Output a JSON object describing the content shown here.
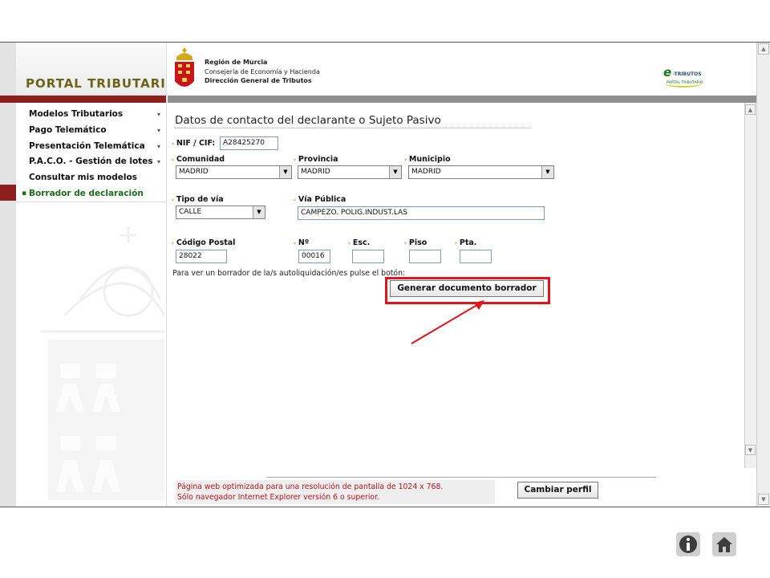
{
  "sidebar": {
    "title": "PORTAL TRIBUTARIO",
    "items": [
      {
        "label": "Modelos Tributarios",
        "expandable": true
      },
      {
        "label": "Pago Telemático",
        "expandable": true
      },
      {
        "label": "Presentación Telemática",
        "expandable": true
      },
      {
        "label": "P.A.C.O. - Gestión de lotes",
        "expandable": true
      },
      {
        "label": "Consultar mis modelos",
        "expandable": false
      },
      {
        "label": "Borrador de declaración",
        "expandable": false,
        "active": true
      }
    ]
  },
  "header": {
    "org_line1": "Región de Murcia",
    "org_line2": "Consejería de Economía y Hacienda",
    "org_line3": "Dirección General de Tributos",
    "brand_big": "e",
    "brand_text": "-TRIBUTOS",
    "brand_sub": "PORTAL TRIBUTARIO"
  },
  "form": {
    "title": "Datos de contacto del declarante o Sujeto Pasivo",
    "nif": {
      "label": "NIF / CIF:",
      "value": "A28425270"
    },
    "comunidad": {
      "label": "Comunidad",
      "value": "MADRID"
    },
    "provincia": {
      "label": "Provincia",
      "value": "MADRID"
    },
    "municipio": {
      "label": "Municipio",
      "value": "MADRID"
    },
    "tipo_via": {
      "label": "Tipo de vía",
      "value": "CALLE"
    },
    "via_publica": {
      "label": "Vía Pública",
      "value": "CAMPEZO. POLIG.INDUST.LAS"
    },
    "codigo_postal": {
      "label": "Código Postal",
      "value": "28022"
    },
    "numero": {
      "label": "Nº",
      "value": "00016"
    },
    "esc": {
      "label": "Esc.",
      "value": ""
    },
    "piso": {
      "label": "Piso",
      "value": ""
    },
    "pta": {
      "label": "Pta.",
      "value": ""
    },
    "hint": "Para ver un borrador de la/s autoliquidación/es pulse el botón:",
    "generate_button": "Generar documento borrador"
  },
  "footer": {
    "line1": "Página web optimizada para una resolución de pantalla de 1024 x 768.",
    "line2": "Sólo navegador Internet Explorer versión 6 o superior.",
    "change_profile_button": "Cambiar perfil"
  },
  "bottom_nav": {
    "info_icon": "info-icon",
    "home_icon": "home-icon"
  },
  "colors": {
    "accent_red": "#8f1e1e",
    "highlight": "#e0151b",
    "footer_text": "#b0141a",
    "active_green": "#1d6b1d"
  }
}
